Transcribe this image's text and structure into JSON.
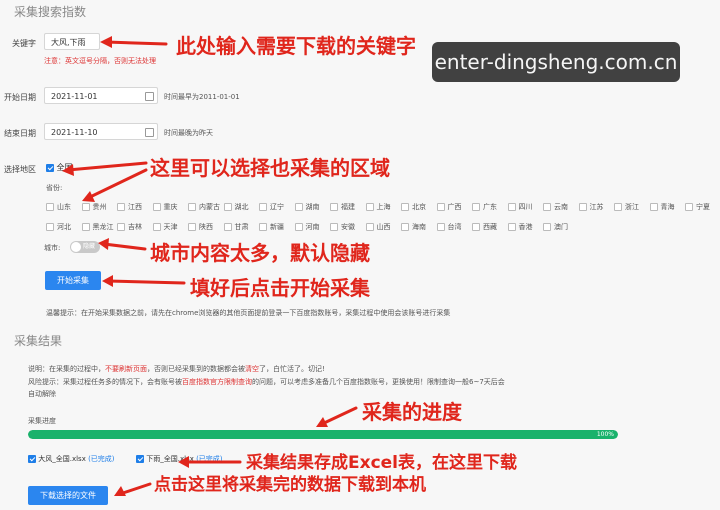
{
  "search_section": {
    "title": "采集搜索指数",
    "keyword_label": "关键字",
    "keyword_value": "大风,下雨",
    "keyword_warning": "注意：英文逗号分隔，否则无法处理",
    "start_label": "开始日期",
    "start_value": "2021-11-01",
    "start_hint": "时间最早为2011-01-01",
    "end_label": "结束日期",
    "end_value": "2021-11-10",
    "end_hint": "时间最晚为昨天",
    "region_label": "选择地区",
    "nationwide_label": "全国",
    "province_label": "省份:",
    "city_label": "城市:",
    "city_toggle_text": "隐藏",
    "provinces_row1": [
      "山东",
      "贵州",
      "江西",
      "重庆",
      "内蒙古",
      "湖北",
      "辽宁",
      "湖南",
      "福建",
      "上海",
      "北京",
      "广西",
      "广东",
      "四川",
      "云南",
      "江苏",
      "浙江",
      "青海",
      "宁夏"
    ],
    "provinces_row2": [
      "河北",
      "黑龙江",
      "吉林",
      "天津",
      "陕西",
      "甘肃",
      "新疆",
      "河南",
      "安徽",
      "山西",
      "海南",
      "台湾",
      "西藏",
      "香港",
      "澳门"
    ],
    "start_button": "开始采集",
    "tip": "温馨提示：在开始采集数据之前，请先在chrome浏览器的其他页面提前登录一下百度指数账号，采集过程中使用会该账号进行采集"
  },
  "result_section": {
    "title": "采集结果",
    "note_prefix": "说明：在采集的过程中，",
    "note_red1": "不要刷新页面",
    "note_mid": "，否则已经采集到的数据都会被",
    "note_red2": "清空",
    "note_suffix": "了，白忙活了。切记!",
    "risk_prefix": "风险提示：采集过程任务多的情况下，会有账号被",
    "risk_red": "百度指数官方限制查询",
    "risk_suffix": "的问题，可以考虑多准备几个百度指数账号，更换使用！限制查询一般6~7天后会",
    "risk_line2": "自动解除",
    "progress_label": "采集进度",
    "progress_percent": 100,
    "progress_text": "100%",
    "file1_name": "大风_全国.xlsx",
    "file1_status": "(已完成)",
    "file2_name": "下雨_全国.xlsx",
    "file2_status": "(已完成)",
    "download_button": "下载选择的文件"
  },
  "annotations": {
    "a1": "此处输入需要下载的关键字",
    "a2": "这里可以选择也采集的区域",
    "a3": "城市内容太多，默认隐藏",
    "a4": "填好后点击开始采集",
    "a5": "采集的进度",
    "a6": "采集结果存成Excel表，在这里下载",
    "a7": "点击这里将采集完的数据下载到本机"
  },
  "watermark": "enter-dingsheng.com.cn",
  "colors": {
    "accent": "#2b86ef",
    "progress": "#19b26b",
    "annotation": "#e0261c",
    "warning": "#d33333"
  }
}
